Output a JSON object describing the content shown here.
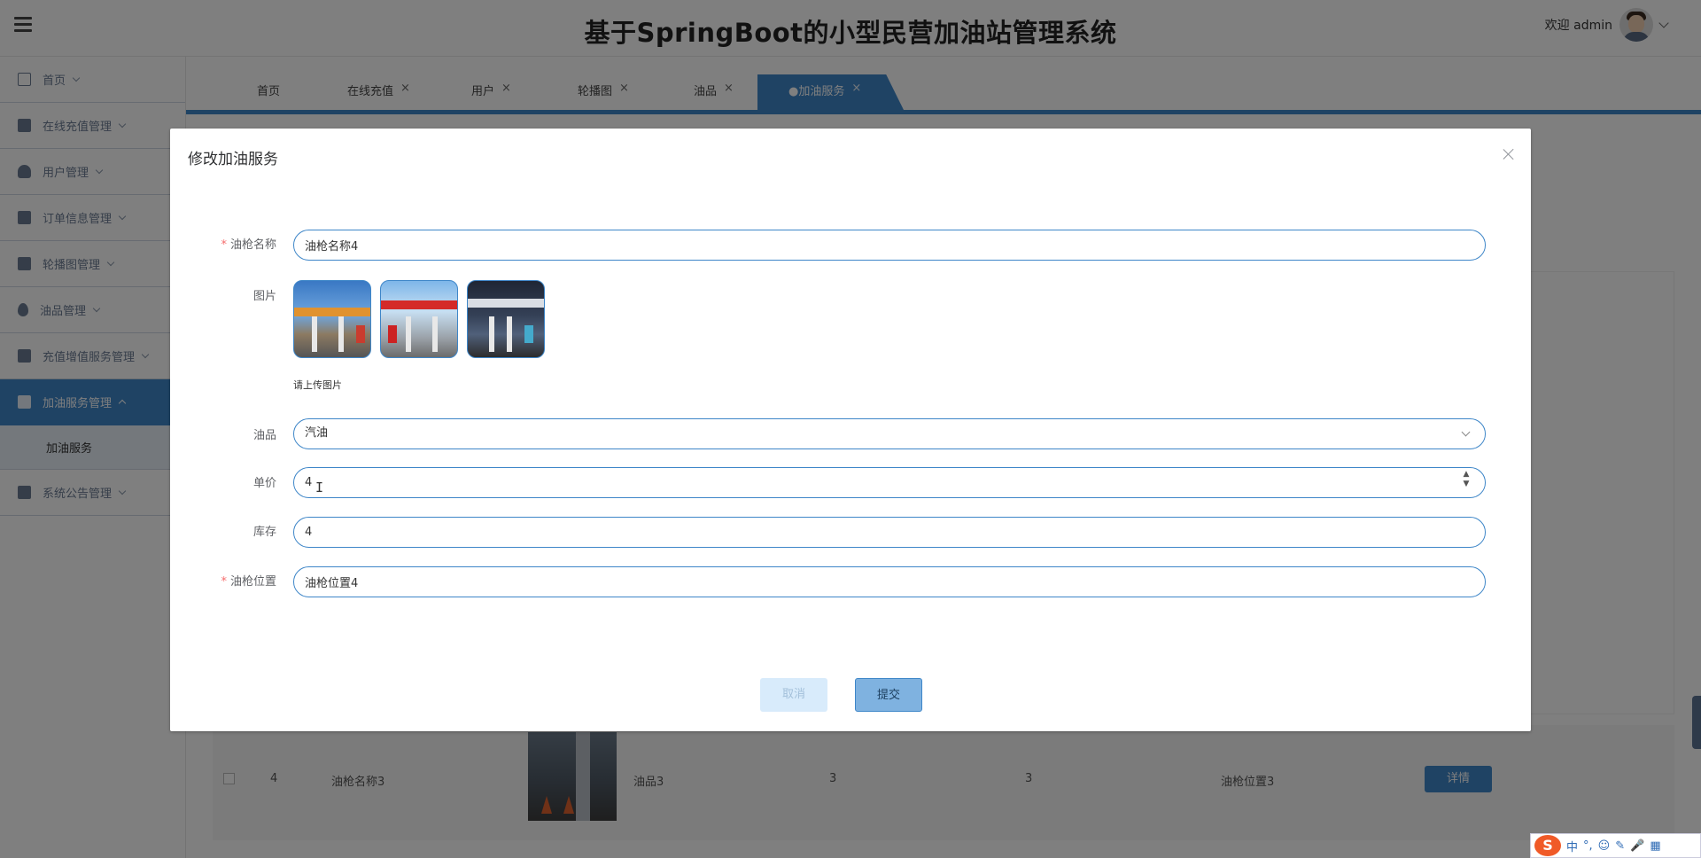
{
  "header": {
    "title": "基于SpringBoot的小型民营加油站管理系统",
    "welcome": "欢迎 admin"
  },
  "sidebar": {
    "items": [
      {
        "label": "首页",
        "icon": "home-icon"
      },
      {
        "label": "在线充值管理",
        "icon": "briefcase-icon"
      },
      {
        "label": "用户管理",
        "icon": "user-icon"
      },
      {
        "label": "订单信息管理",
        "icon": "list-icon"
      },
      {
        "label": "轮播图管理",
        "icon": "briefcase-icon"
      },
      {
        "label": "油品管理",
        "icon": "drop-icon"
      },
      {
        "label": "充值增值服务管理",
        "icon": "book-icon"
      },
      {
        "label": "加油服务管理",
        "icon": "briefcase-icon"
      },
      {
        "label": "系统公告管理",
        "icon": "car-icon"
      }
    ],
    "sub_item": "加油服务"
  },
  "tabs": [
    {
      "label": "首页",
      "closable": false
    },
    {
      "label": "在线充值",
      "closable": true
    },
    {
      "label": "用户",
      "closable": true
    },
    {
      "label": "轮播图",
      "closable": true
    },
    {
      "label": "油品",
      "closable": true
    },
    {
      "label": "●加油服务",
      "closable": true
    }
  ],
  "background_row": {
    "index": "4",
    "name": "油枪名称3",
    "oil": "油品3",
    "price": "3",
    "stock": "3",
    "position": "油枪位置3",
    "detail_label": "详情"
  },
  "dialog": {
    "title": "修改加油服务",
    "fields": {
      "gun_name": {
        "label": "油枪名称",
        "value": "油枪名称4",
        "required": true
      },
      "images": {
        "label": "图片",
        "tip": "请上传图片",
        "count": 3
      },
      "oil": {
        "label": "油品",
        "value": "汽油"
      },
      "price": {
        "label": "单价",
        "value": "4"
      },
      "stock": {
        "label": "库存",
        "value": "4"
      },
      "position": {
        "label": "油枪位置",
        "value": "油枪位置4",
        "required": true
      }
    },
    "cancel_label": "取消",
    "submit_label": "提交"
  },
  "ime": {
    "logo": "S",
    "items": [
      "中",
      "°,",
      "☺",
      "✎",
      "🎤",
      "▦"
    ]
  },
  "colors": {
    "primary": "#3e86c8",
    "required": "#f56c6c",
    "overlay": "rgba(0,0,0,0.5)"
  }
}
